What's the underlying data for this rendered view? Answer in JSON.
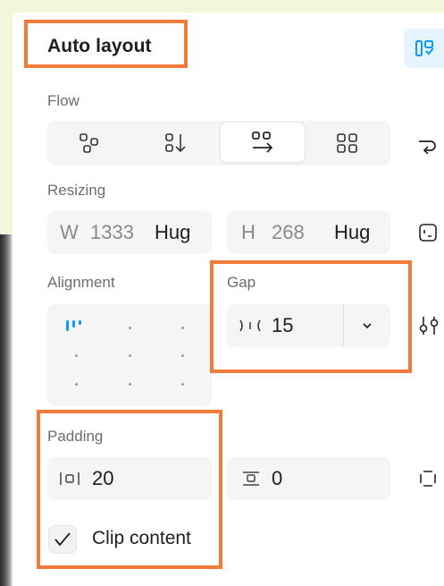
{
  "panel": {
    "title": "Auto layout",
    "layout_icon": "auto-layout-panel-icon"
  },
  "flow": {
    "label": "Flow",
    "options": [
      {
        "name": "freeform",
        "icon": "freeform-icon"
      },
      {
        "name": "vertical",
        "icon": "vertical-flow-icon"
      },
      {
        "name": "horizontal",
        "icon": "horizontal-flow-icon",
        "selected": true
      },
      {
        "name": "grid",
        "icon": "grid-icon"
      }
    ],
    "wrap_icon": "wrap-icon"
  },
  "resizing": {
    "label": "Resizing",
    "width_prefix": "W",
    "width_value": "1333",
    "width_mode": "Hug",
    "height_prefix": "H",
    "height_value": "268",
    "height_mode": "Hug",
    "constraints_icon": "resize-constraints-icon"
  },
  "alignment": {
    "label": "Alignment",
    "selected": "top-left"
  },
  "gap": {
    "label": "Gap",
    "value": "15",
    "dropdown_icon": "chevron-down-icon",
    "settings_icon": "layout-settings-icon"
  },
  "padding": {
    "label": "Padding",
    "horizontal_value": "20",
    "vertical_value": "0",
    "individual_icon": "individual-padding-icon"
  },
  "clip": {
    "label": "Clip content",
    "checked": true
  },
  "colors": {
    "highlight": "#f27a3a",
    "accent": "#0d99ff",
    "background": "#f1f7d9"
  }
}
